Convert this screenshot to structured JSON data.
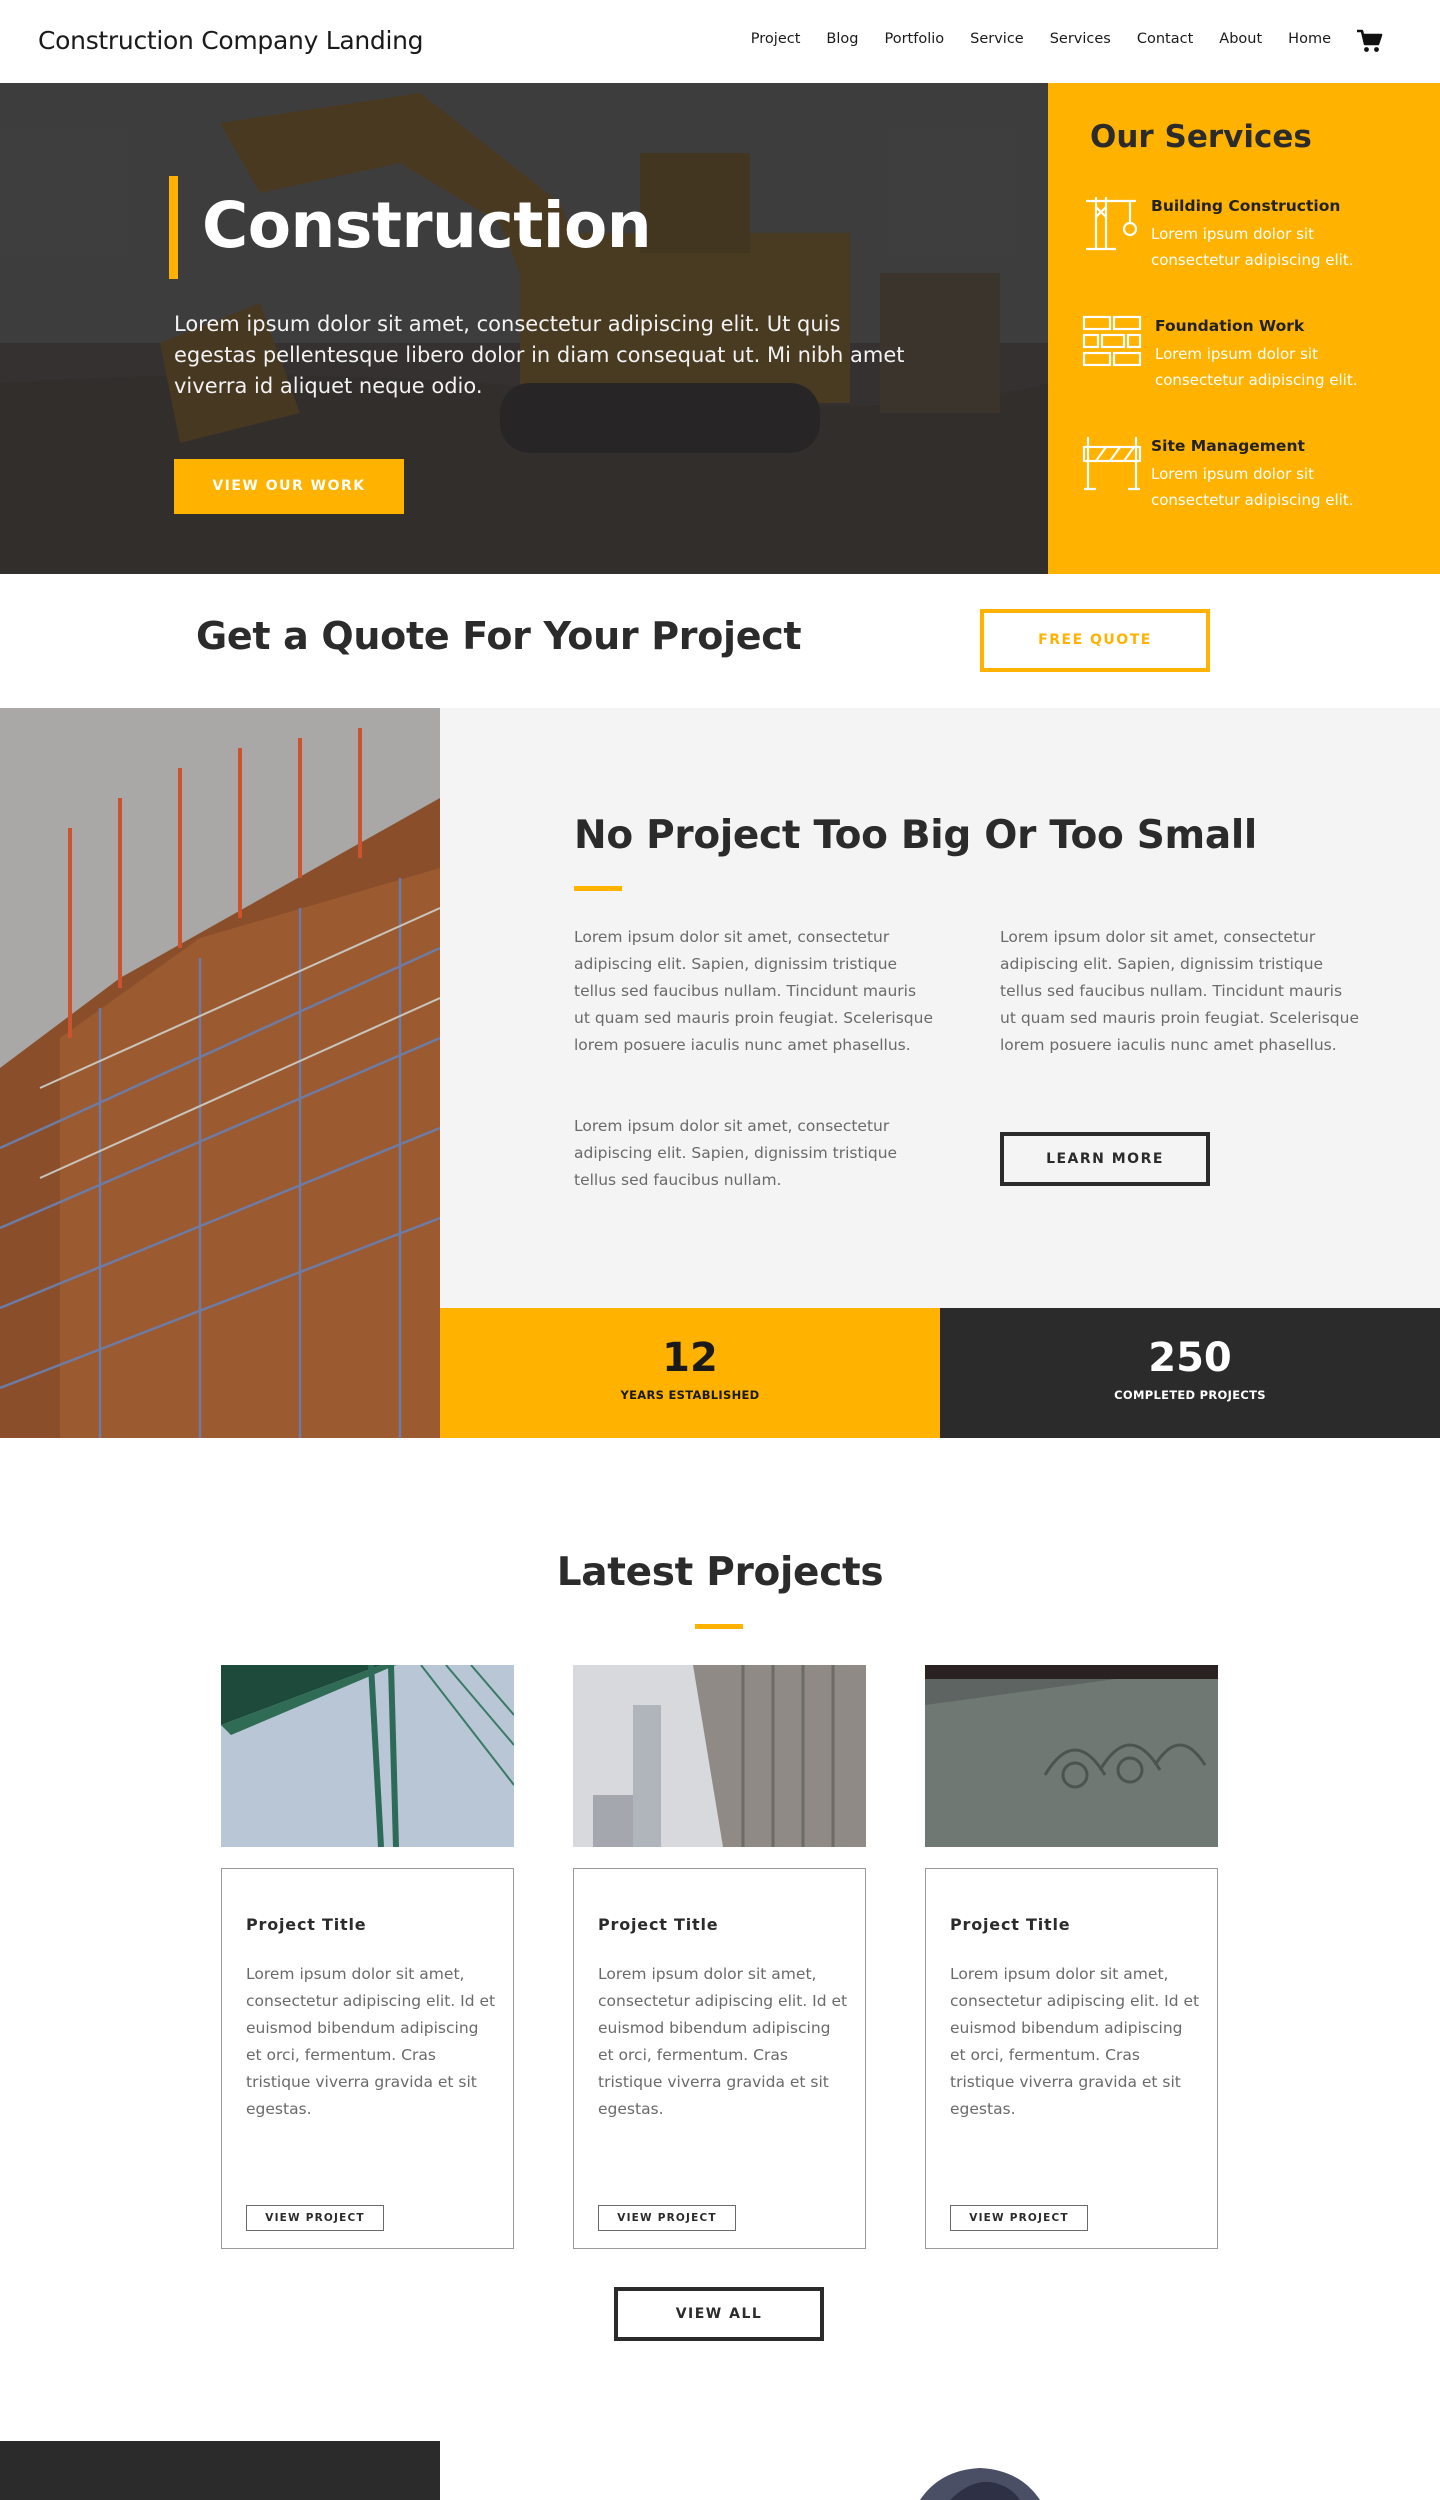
{
  "header": {
    "brand": "Construction Company Landing",
    "nav": [
      "Project",
      "Blog",
      "Portfolio",
      "Service",
      "Services",
      "Contact",
      "About",
      "Home"
    ],
    "cart_icon": "cart-icon"
  },
  "hero": {
    "title": "Construction",
    "text": "Lorem ipsum dolor sit amet, consectetur adipiscing elit. Ut quis egestas pellentesque libero dolor in diam consequat ut. Mi nibh amet viverra id aliquet neque odio.",
    "button": "VIEW OUR WORK"
  },
  "services": {
    "heading": "Our Services",
    "items": [
      {
        "title": "Building Construction",
        "desc": "Lorem ipsum dolor sit consectetur adipiscing elit.",
        "icon": "crane-icon"
      },
      {
        "title": "Foundation Work",
        "desc": "Lorem ipsum dolor sit consectetur adipiscing elit.",
        "icon": "bricks-icon"
      },
      {
        "title": "Site Management",
        "desc": "Lorem ipsum dolor sit consectetur adipiscing elit.",
        "icon": "barrier-icon"
      }
    ]
  },
  "quote": {
    "heading": "Get a Quote For Your Project",
    "button": "FREE QUOTE"
  },
  "about": {
    "heading": "No Project Too Big Or Too Small",
    "col1_p1": "Lorem ipsum dolor sit amet, consectetur adipiscing elit. Sapien, dignissim tristique tellus sed faucibus nullam. Tincidunt mauris ut quam sed mauris proin feugiat. Scelerisque lorem posuere iaculis nunc amet phasellus.",
    "col1_p2": "Lorem ipsum dolor sit amet, consectetur adipiscing elit. Sapien, dignissim tristique tellus sed faucibus nullam.",
    "col2_p1": "Lorem ipsum dolor sit amet, consectetur adipiscing elit. Sapien, dignissim tristique tellus sed faucibus nullam. Tincidunt mauris ut quam sed mauris proin feugiat. Scelerisque lorem posuere iaculis nunc amet phasellus.",
    "button": "LEARN MORE"
  },
  "stats": [
    {
      "number": "12",
      "label": "YEARS ESTABLISHED"
    },
    {
      "number": "250",
      "label": "COMPLETED PROJECTS"
    }
  ],
  "latest": {
    "heading": "Latest Projects",
    "cards": [
      {
        "title": "Project Title",
        "desc": "Lorem ipsum dolor sit amet, consectetur adipiscing elit. Id et euismod bibendum adipiscing et orci, fermentum. Cras tristique viverra gravida et sit egestas.",
        "button": "VIEW PROJECT"
      },
      {
        "title": "Project Title",
        "desc": "Lorem ipsum dolor sit amet, consectetur adipiscing elit. Id et euismod bibendum adipiscing et orci, fermentum. Cras tristique viverra gravida et sit egestas.",
        "button": "VIEW PROJECT"
      },
      {
        "title": "Project Title",
        "desc": "Lorem ipsum dolor sit amet, consectetur adipiscing elit. Id et euismod bibendum adipiscing et orci, fermentum. Cras tristique viverra gravida et sit egestas.",
        "button": "VIEW PROJECT"
      }
    ],
    "view_all": "VIEW ALL"
  },
  "colors": {
    "accent": "#ffb300",
    "dark": "#2b2b2b",
    "light_bg": "#f4f4f4"
  }
}
